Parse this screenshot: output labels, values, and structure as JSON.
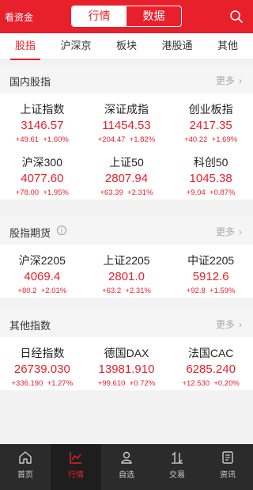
{
  "header": {
    "left_link": "看资金",
    "segments": [
      "行情",
      "数据"
    ],
    "active_segment": 0
  },
  "tabs": [
    "股指",
    "沪深京",
    "板块",
    "港股通",
    "其他"
  ],
  "sections": {
    "domestic": {
      "title": "国内股指",
      "more": "更多",
      "items": [
        {
          "name": "上证指数",
          "price": "3146.57",
          "change": "+49.61",
          "pct": "+1.60%"
        },
        {
          "name": "深证成指",
          "price": "11454.53",
          "change": "+204.47",
          "pct": "+1.82%"
        },
        {
          "name": "创业板指",
          "price": "2417.35",
          "change": "+40.22",
          "pct": "+1.69%"
        },
        {
          "name": "沪深300",
          "price": "4077.60",
          "change": "+78.00",
          "pct": "+1.95%"
        },
        {
          "name": "上证50",
          "price": "2807.94",
          "change": "+63.39",
          "pct": "+2.31%"
        },
        {
          "name": "科创50",
          "price": "1045.38",
          "change": "+9.04",
          "pct": "+0.87%"
        }
      ]
    },
    "futures": {
      "title": "股指期货",
      "more": "更多",
      "items": [
        {
          "name": "沪深2205",
          "price": "4069.4",
          "change": "+80.2",
          "pct": "+2.01%"
        },
        {
          "name": "上证2205",
          "price": "2801.0",
          "change": "+63.2",
          "pct": "+2.31%"
        },
        {
          "name": "中证2205",
          "price": "5912.6",
          "change": "+92.8",
          "pct": "+1.59%"
        }
      ]
    },
    "other": {
      "title": "其他指数",
      "more": "更多",
      "items": [
        {
          "name": "日经指数",
          "price": "26739.030",
          "change": "+336.190",
          "pct": "+1.27%"
        },
        {
          "name": "德国DAX",
          "price": "13981.910",
          "change": "+99.610",
          "pct": "+0.72%"
        },
        {
          "name": "法国CAC",
          "price": "6285.240",
          "change": "+12.530",
          "pct": "+0.20%"
        }
      ]
    }
  },
  "bottom_nav": [
    {
      "label": "首页",
      "icon": "home-icon"
    },
    {
      "label": "行情",
      "icon": "chart-icon"
    },
    {
      "label": "自选",
      "icon": "user-icon"
    },
    {
      "label": "交易",
      "icon": "exchange-icon"
    },
    {
      "label": "资讯",
      "icon": "news-icon"
    }
  ],
  "colors": {
    "accent": "#e8202c",
    "nav_bg": "#2b2b2b"
  }
}
